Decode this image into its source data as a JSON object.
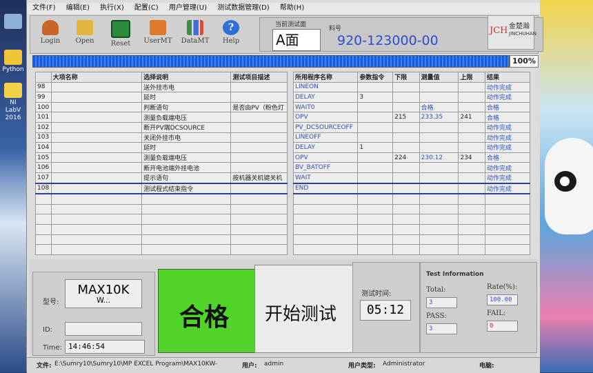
{
  "desktop": {
    "left_icons": [
      {
        "label": "Python"
      },
      {
        "label": "NI LabV 2016"
      }
    ]
  },
  "menu": [
    "文件(F)",
    "编辑(E)",
    "执行(X)",
    "配置(C)",
    "用户管理(U)",
    "测试数据管理(D)",
    "帮助(H)"
  ],
  "toolbar": [
    {
      "label": "Login",
      "icon": "users-icon",
      "color": "#c8662a"
    },
    {
      "label": "Open",
      "icon": "folder-icon",
      "color": "#e0b640"
    },
    {
      "label": "Reset",
      "icon": "clock-icon",
      "color": "#2c8a3a"
    },
    {
      "label": "UserMT",
      "icon": "user-edit-icon",
      "color": "#e07a2a"
    },
    {
      "label": "DataMT",
      "icon": "chart-icon",
      "color": "#3a8c46"
    },
    {
      "label": "Help",
      "icon": "help-icon",
      "color": "#2f6fd8"
    }
  ],
  "current_test": {
    "label": "当前测试面",
    "face": "A面",
    "part_label": "料号",
    "part_no": "920-123000-00"
  },
  "logo": {
    "mark": "JCH",
    "cn": "金楚瀚",
    "en": "JINCHUHAN"
  },
  "progress": {
    "value": 100,
    "text": "100%"
  },
  "left_table": {
    "headers": [
      "",
      "大项名称",
      "选择说明",
      "测试项目描述"
    ],
    "rows": [
      [
        "98",
        "",
        "送外挂市电",
        ""
      ],
      [
        "99",
        "",
        "延时",
        ""
      ],
      [
        "100",
        "",
        "判断语句",
        "是否由PV（粉色灯"
      ],
      [
        "101",
        "",
        "测量负载端电压",
        ""
      ],
      [
        "102",
        "",
        "断开PV端DCSOURCE",
        ""
      ],
      [
        "103",
        "",
        "关闭外挂市电",
        ""
      ],
      [
        "104",
        "",
        "延时",
        ""
      ],
      [
        "105",
        "",
        "测量负载端电压",
        ""
      ],
      [
        "106",
        "",
        "断开电池端外挂电池",
        ""
      ],
      [
        "107",
        "",
        "提示语句",
        "按机器关机键关机"
      ],
      [
        "108",
        "",
        "测试程式结束指令",
        ""
      ],
      [
        "",
        "",
        "",
        ""
      ],
      [
        "",
        "",
        "",
        ""
      ],
      [
        "",
        "",
        "",
        ""
      ],
      [
        "",
        "",
        "",
        ""
      ],
      [
        "",
        "",
        "",
        ""
      ],
      [
        "",
        "",
        "",
        ""
      ]
    ]
  },
  "right_table": {
    "headers": [
      "所用程序名称",
      "参数指令",
      "下限",
      "测量值",
      "上限",
      "结果"
    ],
    "rows": [
      [
        "LINEON",
        "",
        "",
        "",
        "",
        "动作完成"
      ],
      [
        "DELAY",
        "3",
        "",
        "",
        "",
        "动作完成"
      ],
      [
        "WAIT0",
        "",
        "",
        "合格",
        "",
        "合格"
      ],
      [
        "OPV",
        "",
        "215",
        "233.35",
        "241",
        "合格"
      ],
      [
        "PV_DCSOURCEOFF",
        "",
        "",
        "",
        "",
        "动作完成"
      ],
      [
        "LINEOFF",
        "",
        "",
        "",
        "",
        "动作完成"
      ],
      [
        "DELAY",
        "1",
        "",
        "",
        "",
        "动作完成"
      ],
      [
        "OPV",
        "",
        "224",
        "230.12",
        "234",
        "合格"
      ],
      [
        "BV_BATOFF",
        "",
        "",
        "",
        "",
        "动作完成"
      ],
      [
        "WAIT",
        "",
        "",
        "",
        "",
        "动作完成"
      ],
      [
        "END",
        "",
        "",
        "",
        "",
        "动作完成"
      ],
      [
        "",
        "",
        "",
        "",
        "",
        ""
      ],
      [
        "",
        "",
        "",
        "",
        "",
        ""
      ],
      [
        "",
        "",
        "",
        "",
        "",
        ""
      ],
      [
        "",
        "",
        "",
        "",
        "",
        ""
      ],
      [
        "",
        "",
        "",
        "",
        "",
        ""
      ],
      [
        "",
        "",
        "",
        "",
        "",
        ""
      ]
    ]
  },
  "info": {
    "model_label": "型号:",
    "model_value": "MAX10K",
    "model_suffix": "W...",
    "id_label": "ID:",
    "id_value": "",
    "time_label": "Time:",
    "time_value": "14:46:54"
  },
  "result": {
    "text": "合格",
    "color": "#52d32a"
  },
  "start_button": "开始测试",
  "test_time": {
    "label": "测试时间:",
    "value": "05:12"
  },
  "test_info": {
    "title": "Test Information",
    "total_label": "Total:",
    "total": "3",
    "rate_label": "Rate(%):",
    "rate": "100.00",
    "pass_label": "PASS:",
    "pass": "3",
    "fail_label": "FAIL:",
    "fail": "0"
  },
  "status": {
    "file_label": "文件:",
    "file": "E:\\Sumry10\\Sumry10\\MP EXCEL Program\\MAX10KW-",
    "user_label": "用户:",
    "user": "admin",
    "user_type_label": "用户类型:",
    "user_type": "Administrator",
    "power_label": "电脑:"
  }
}
